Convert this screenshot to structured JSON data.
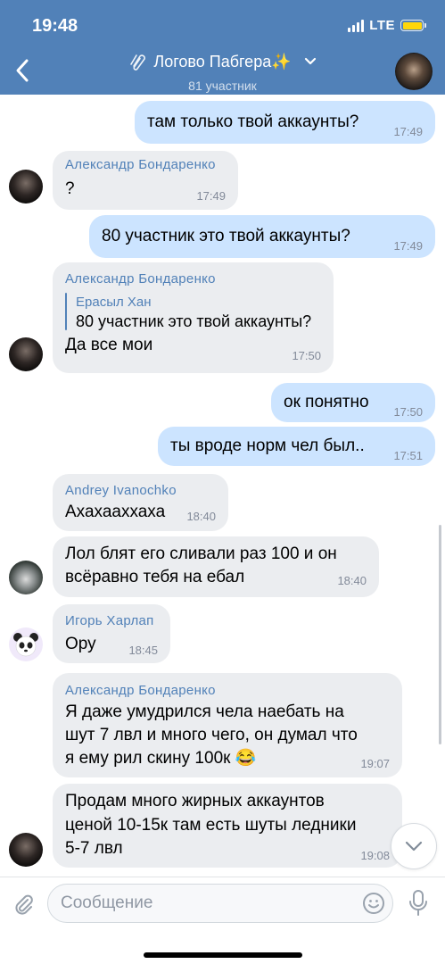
{
  "status_bar": {
    "time": "19:48",
    "network": "LTE",
    "battery_color": "#ffd60a"
  },
  "header": {
    "title": "Логово Пабгера✨",
    "title_icon": "paperclip-icon",
    "subtitle": "81 участник",
    "background": "#5181b8"
  },
  "messages": [
    {
      "direction": "out",
      "text": "там только твой аккаунты?",
      "time": "17:49"
    },
    {
      "direction": "in",
      "sender": "Александр Бондаренко",
      "text": "?",
      "time": "17:49",
      "avatar": "dark"
    },
    {
      "direction": "out",
      "text": "80 участник это твой аккаунты?",
      "time": "17:49"
    },
    {
      "direction": "in",
      "sender": "Александр Бондаренко",
      "reply": {
        "name": "Ерасыл Хан",
        "text": "80 участник это твой аккаунты?"
      },
      "text": "Да все мои",
      "time": "17:50",
      "avatar": "dark"
    },
    {
      "direction": "out",
      "text": "ок понятно",
      "time": "17:50"
    },
    {
      "direction": "out",
      "text": "ты вроде норм чел был..",
      "time": "17:51"
    },
    {
      "direction": "in",
      "sender": "Andrey Ivanochko",
      "text": "Ахахааххаха",
      "time": "18:40"
    },
    {
      "direction": "in",
      "lines": [
        "Лол блят его сливали раз 100 и он",
        "всёравно тебя на ебал"
      ],
      "time": "18:40",
      "avatar": "car"
    },
    {
      "direction": "in",
      "sender": "Игорь Харлап",
      "text": "Ору",
      "time": "18:45",
      "avatar": "panda"
    },
    {
      "direction": "in",
      "sender": "Александр Бондаренко",
      "lines": [
        "Я даже умудрился чела наебать на",
        "шут 7 лвл и много чего, он думал что",
        "я ему рил скину 100к 😂"
      ],
      "time": "19:07"
    },
    {
      "direction": "in",
      "lines": [
        "Продам много жирных аккаунтов",
        "ценой 10-15к там есть шуты ледники",
        "5-7 лвл"
      ],
      "time": "19:08",
      "avatar": "dark"
    }
  ],
  "composer": {
    "placeholder": "Сообщение"
  },
  "colors": {
    "accent": "#5181b8",
    "outgoing_bubble": "#cce4ff",
    "incoming_bubble": "#ebedf0"
  }
}
